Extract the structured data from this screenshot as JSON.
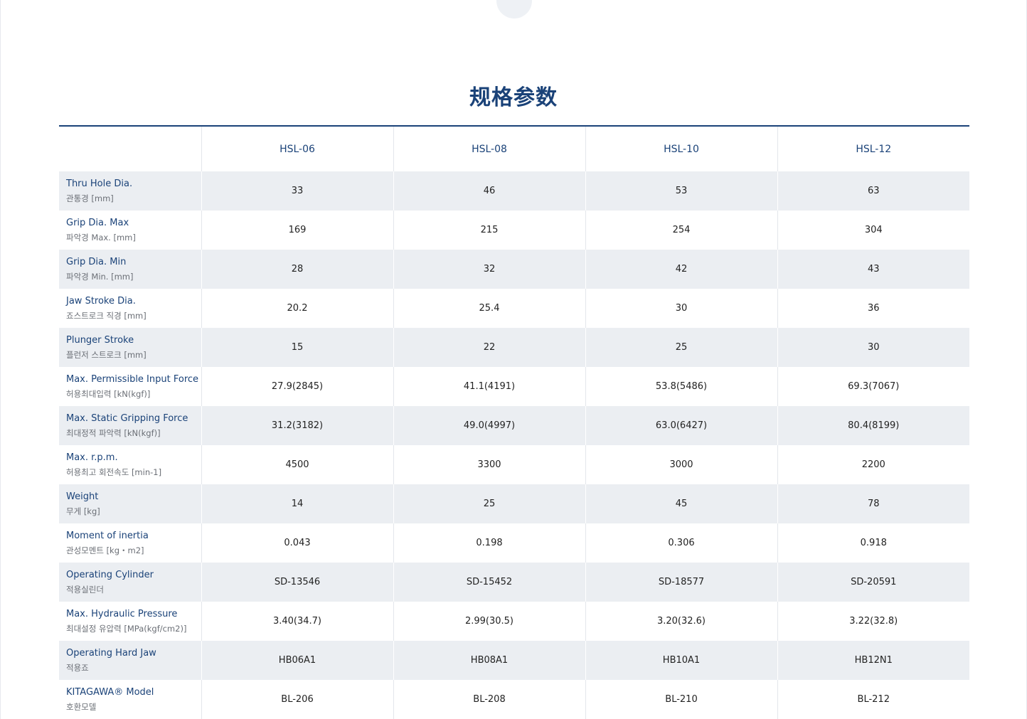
{
  "title": "规格参数",
  "models": [
    "HSL-06",
    "HSL-08",
    "HSL-10",
    "HSL-12"
  ],
  "rows": [
    {
      "en": "Thru Hole Dia.",
      "ko": "관통경 [mm]",
      "values": [
        "33",
        "46",
        "53",
        "63"
      ]
    },
    {
      "en": "Grip Dia. Max",
      "ko": "파악경 Max. [mm]",
      "values": [
        "169",
        "215",
        "254",
        "304"
      ]
    },
    {
      "en": "Grip Dia. Min",
      "ko": "파악경 Min. [mm]",
      "values": [
        "28",
        "32",
        "42",
        "43"
      ]
    },
    {
      "en": "Jaw Stroke Dia.",
      "ko": "죠스트로크 직경 [mm]",
      "values": [
        "20.2",
        "25.4",
        "30",
        "36"
      ]
    },
    {
      "en": "Plunger Stroke",
      "ko": "플런저 스트로크 [mm]",
      "values": [
        "15",
        "22",
        "25",
        "30"
      ]
    },
    {
      "en": "Max. Permissible Input Force",
      "ko": "허용최대입력 [kN(kgf)]",
      "values": [
        "27.9(2845)",
        "41.1(4191)",
        "53.8(5486)",
        "69.3(7067)"
      ]
    },
    {
      "en": "Max. Static Gripping Force",
      "ko": "최대정적 파악력 [kN(kgf)]",
      "values": [
        "31.2(3182)",
        "49.0(4997)",
        "63.0(6427)",
        "80.4(8199)"
      ]
    },
    {
      "en": "Max. r.p.m.",
      "ko": "허용최고 회전속도 [min-1]",
      "values": [
        "4500",
        "3300",
        "3000",
        "2200"
      ]
    },
    {
      "en": "Weight",
      "ko": "무게 [kg]",
      "values": [
        "14",
        "25",
        "45",
        "78"
      ]
    },
    {
      "en": "Moment of inertia",
      "ko": "관성모멘트 [kg・m2]",
      "values": [
        "0.043",
        "0.198",
        "0.306",
        "0.918"
      ]
    },
    {
      "en": "Operating Cylinder",
      "ko": "적용실린더",
      "values": [
        "SD-13546",
        "SD-15452",
        "SD-18577",
        "SD-20591"
      ]
    },
    {
      "en": "Max. Hydraulic Pressure",
      "ko": "최대설정 유압력 [MPa(kgf/cm2)]",
      "values": [
        "3.40(34.7)",
        "2.99(30.5)",
        "3.20(32.6)",
        "3.22(32.8)"
      ]
    },
    {
      "en": "Operating Hard Jaw",
      "ko": "적용죠",
      "values": [
        "HB06A1",
        "HB08A1",
        "HB10A1",
        "HB12N1"
      ]
    },
    {
      "en": "KITAGAWA® Model",
      "ko": "호환모델",
      "values": [
        "BL-206",
        "BL-208",
        "BL-210",
        "BL-212"
      ]
    }
  ]
}
